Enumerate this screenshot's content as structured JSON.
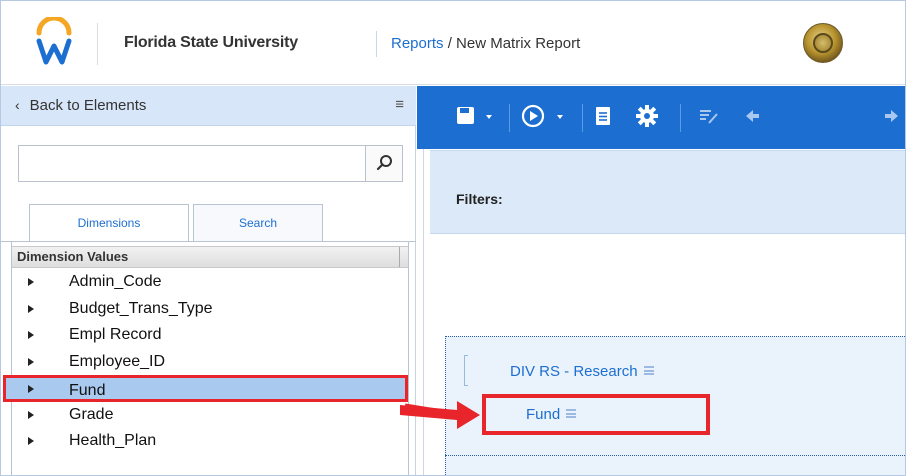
{
  "header": {
    "org_name": "Florida State University",
    "breadcrumb_link": "Reports",
    "breadcrumb_sep": " / ",
    "breadcrumb_current": "New Matrix Report",
    "logo_icon": "workday-logo-icon",
    "seal_icon": "university-seal-icon"
  },
  "left_panel": {
    "back_label": "Back to Elements",
    "menu_icon": "hamburger-icon",
    "search": {
      "value": "",
      "placeholder": "",
      "icon": "search-icon"
    },
    "tabs": [
      {
        "label": "Dimensions",
        "active": true
      },
      {
        "label": "Search",
        "active": false
      }
    ],
    "dimension_header": "Dimension Values",
    "dimensions": [
      {
        "label": "Admin_Code",
        "selected": false
      },
      {
        "label": "Budget_Trans_Type",
        "selected": false
      },
      {
        "label": "Empl Record",
        "selected": false
      },
      {
        "label": "Employee_ID",
        "selected": false
      },
      {
        "label": "Fund",
        "selected": true
      },
      {
        "label": "Grade",
        "selected": false
      },
      {
        "label": "Health_Plan",
        "selected": false
      }
    ]
  },
  "toolbar": {
    "icons": [
      "save-icon",
      "run-icon",
      "document-icon",
      "settings-icon",
      "edit-icon",
      "arrow-left-icon",
      "arrow-right-icon"
    ]
  },
  "report": {
    "filters_label": "Filters:",
    "rows": [
      {
        "label": "DIV RS - Research"
      },
      {
        "label": "Fund"
      }
    ]
  },
  "colors": {
    "brand_blue": "#1c6fd1",
    "highlight_red": "#e8252a",
    "selected_row": "#a9c9ef",
    "panel_bg": "#dbe9f8"
  }
}
